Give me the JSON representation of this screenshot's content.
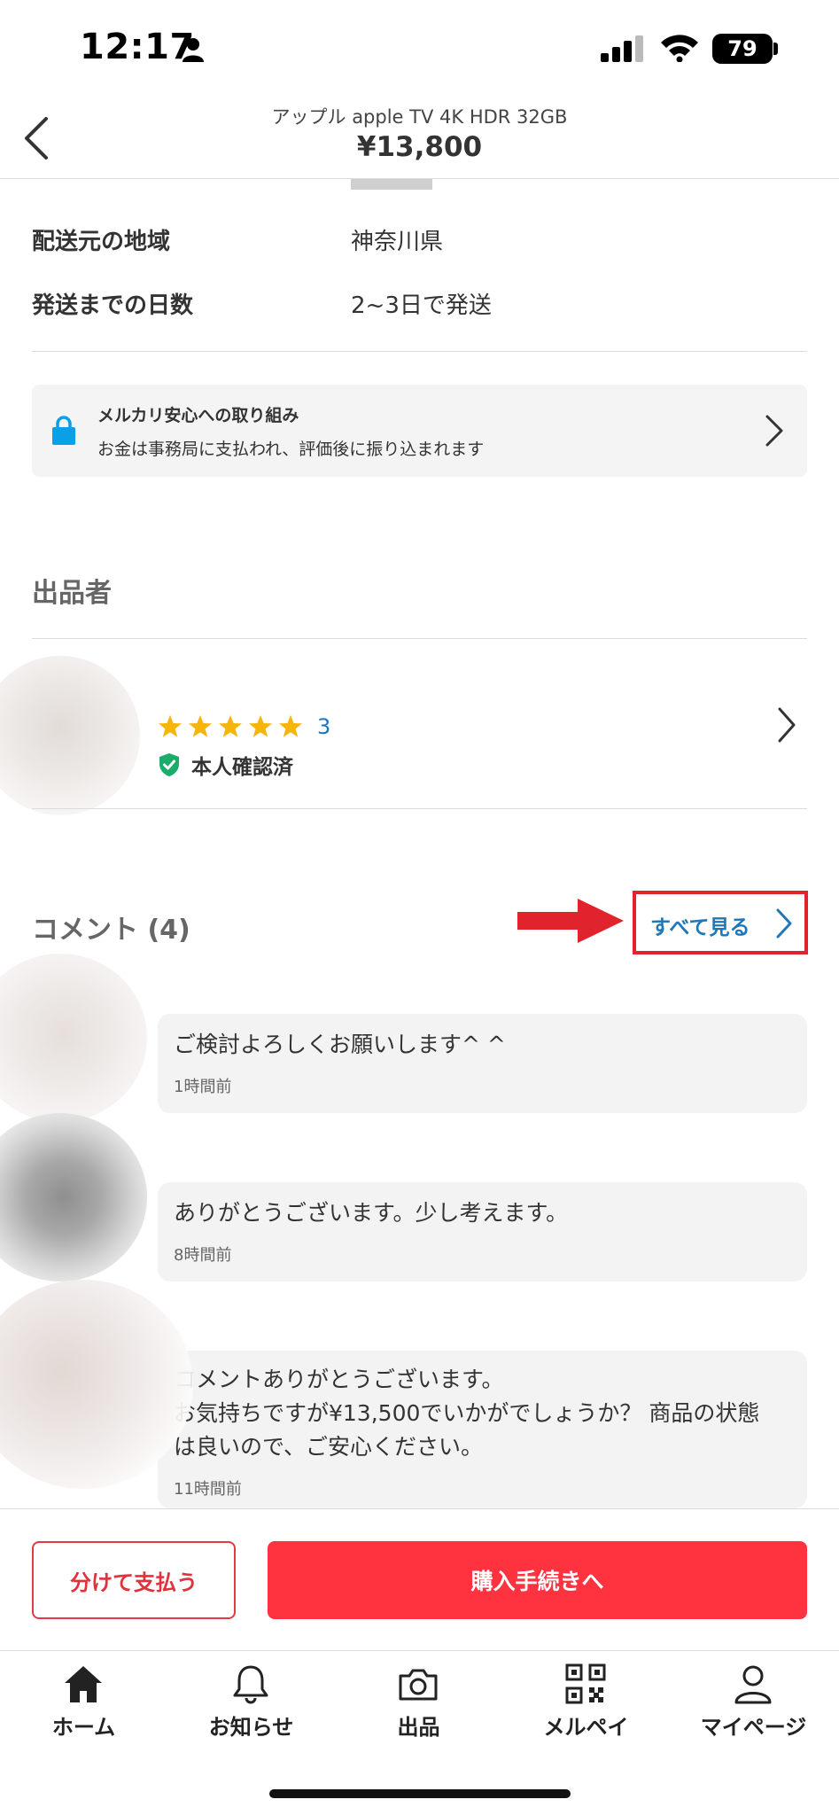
{
  "status_bar": {
    "time": "12:17",
    "battery": "79"
  },
  "header": {
    "title": "アップル apple TV 4K HDR 32GB",
    "price": "¥13,800"
  },
  "shipping": {
    "rows": [
      {
        "label": "配送元の地域",
        "value": "神奈川県"
      },
      {
        "label": "発送までの日数",
        "value": "2~3日で発送"
      }
    ]
  },
  "safety": {
    "title": "メルカリ安心への取り組み",
    "subtitle": "お金は事務局に支払われ、評価後に振り込まれます"
  },
  "seller": {
    "heading": "出品者",
    "rating_count": "3",
    "rating_stars": 5,
    "verified": "本人確認済"
  },
  "comments": {
    "heading": "コメント (4)",
    "see_all": "すべて見る",
    "items": [
      {
        "text": "ご検討よろしくお願いします^ ^",
        "time": "1時間前"
      },
      {
        "text": "ありがとうございます。少し考えます。",
        "time": "8時間前"
      },
      {
        "text": "コメントありがとうございます。\nお気持ちですが¥13,500でいかがでしょうか？ 商品の状態\nは良いので、ご安心ください。",
        "time": "11時間前"
      }
    ]
  },
  "actions": {
    "split_pay": "分けて支払う",
    "purchase": "購入手続きへ"
  },
  "tabs": [
    {
      "label": "ホーム",
      "icon": "home-icon"
    },
    {
      "label": "お知らせ",
      "icon": "bell-icon"
    },
    {
      "label": "出品",
      "icon": "camera-icon"
    },
    {
      "label": "メルペイ",
      "icon": "qr-code-icon"
    },
    {
      "label": "マイページ",
      "icon": "person-icon"
    }
  ],
  "colors": {
    "brand_red": "#ff333f",
    "link_blue": "#1d77b8",
    "star_yellow": "#f5b50a",
    "verified_green": "#1bab6b",
    "lock_blue": "#0aa0e6"
  }
}
